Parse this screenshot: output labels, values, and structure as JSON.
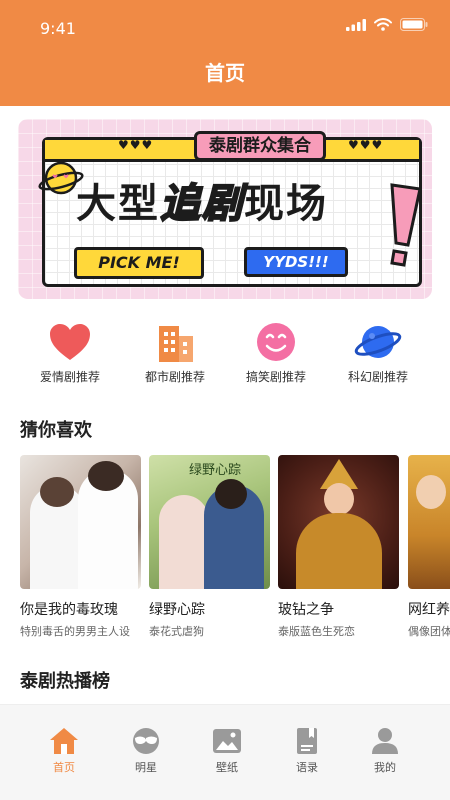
{
  "status": {
    "time": "9:41"
  },
  "header": {
    "title": "首页"
  },
  "banner": {
    "tag": "泰剧群众集合",
    "title_part1": "大型",
    "title_accent": "追剧",
    "title_part2": "现场",
    "button1": "PICK ME!",
    "button2": "YYDS!!!",
    "hearts": "♥♥♥"
  },
  "categories": [
    {
      "label": "爱情剧推荐",
      "icon": "heart-icon",
      "color": "#EE5A5A"
    },
    {
      "label": "都市剧推荐",
      "icon": "building-icon",
      "color": "#F08A45"
    },
    {
      "label": "搞笑剧推荐",
      "icon": "smile-icon",
      "color": "#F46FA3"
    },
    {
      "label": "科幻剧推荐",
      "icon": "planet-icon",
      "color": "#2E6BF0"
    }
  ],
  "sections": {
    "recommend": "猜你喜欢",
    "hot": "泰剧热播榜"
  },
  "recommendations": [
    {
      "title": "你是我的毒玫瑰",
      "subtitle": "特别毒舌的男男主人设",
      "overlay": ""
    },
    {
      "title": "绿野心踪",
      "subtitle": "泰花式虐狗",
      "overlay": "绿野心踪"
    },
    {
      "title": "玻钻之争",
      "subtitle": "泰版蓝色生死恋",
      "overlay": ""
    },
    {
      "title": "网红养成记",
      "subtitle": "偶像团体",
      "overlay": ""
    }
  ],
  "tabs": [
    {
      "label": "首页",
      "icon": "home-icon",
      "active": true
    },
    {
      "label": "明星",
      "icon": "star-mask-icon",
      "active": false
    },
    {
      "label": "壁纸",
      "icon": "image-icon",
      "active": false
    },
    {
      "label": "语录",
      "icon": "book-icon",
      "active": false
    },
    {
      "label": "我的",
      "icon": "user-icon",
      "active": false
    }
  ],
  "colors": {
    "accent": "#F08A45",
    "tab_inactive": "#9A9A9A"
  }
}
